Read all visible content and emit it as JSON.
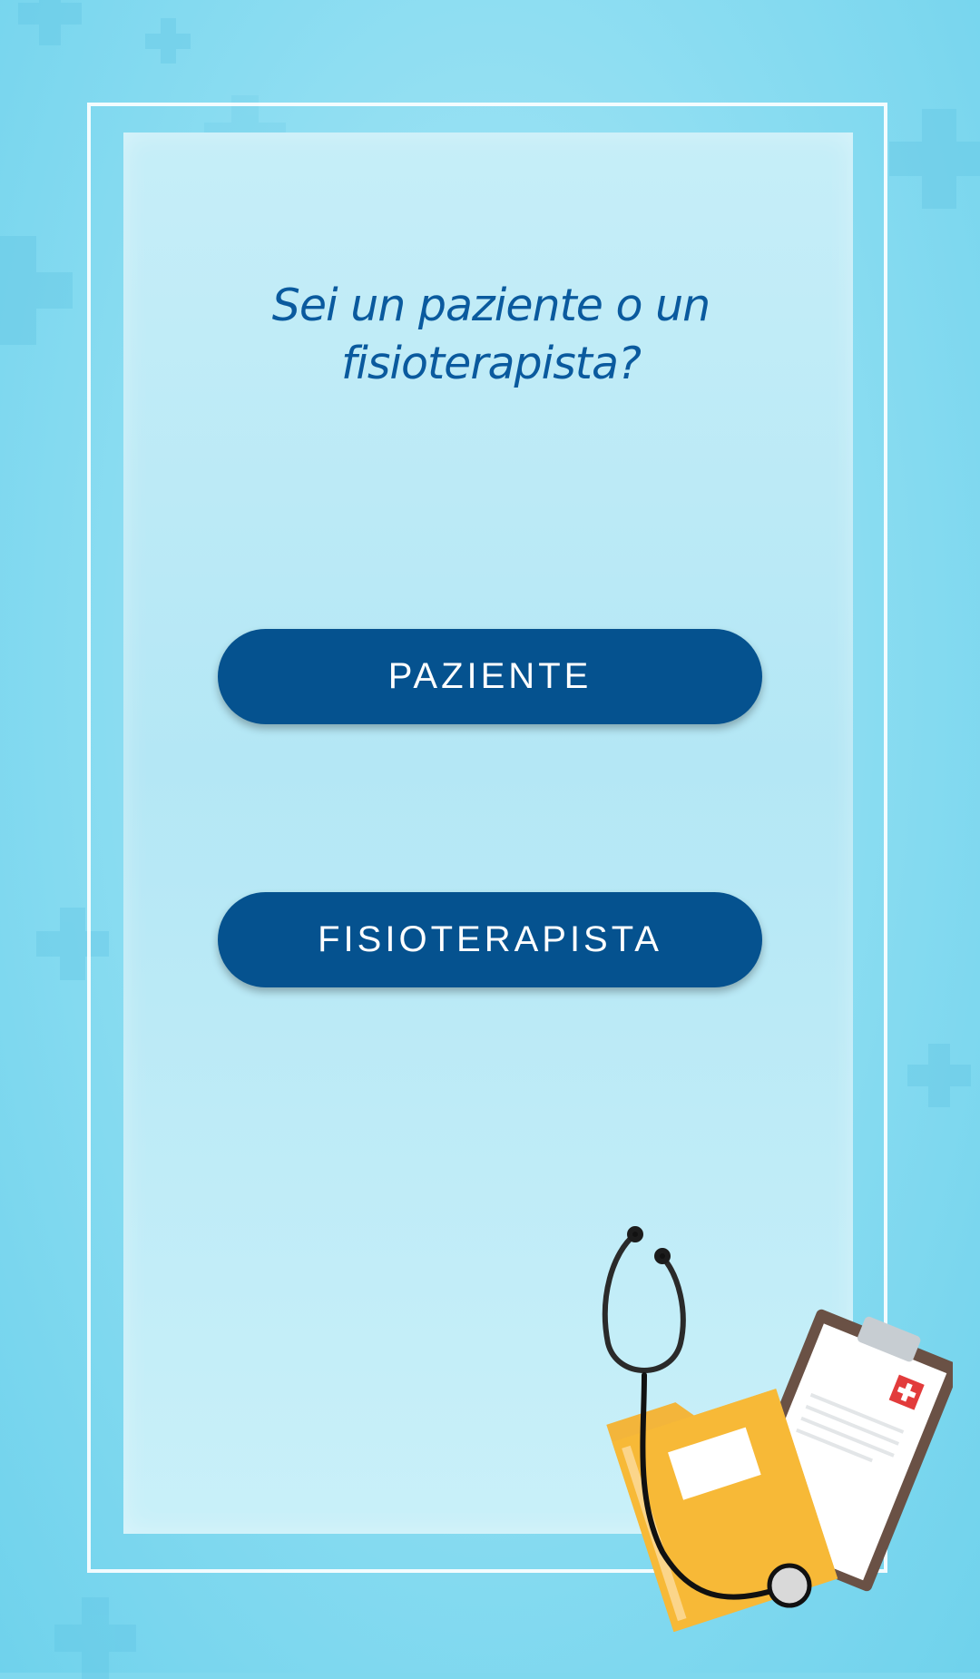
{
  "screen": {
    "question": "Sei un paziente o un\nfisioterapista?"
  },
  "buttons": {
    "patient_label": "PAZIENTE",
    "physio_label": "FISIOTERAPISTA"
  },
  "colors": {
    "primary": "#05528F",
    "title": "#0A5A9E",
    "background": "#89DCF1",
    "panel": "#C6EEF8"
  },
  "illustration": {
    "icons": [
      "stethoscope-icon",
      "folder-icon",
      "clipboard-icon",
      "medical-cross-icon"
    ]
  }
}
